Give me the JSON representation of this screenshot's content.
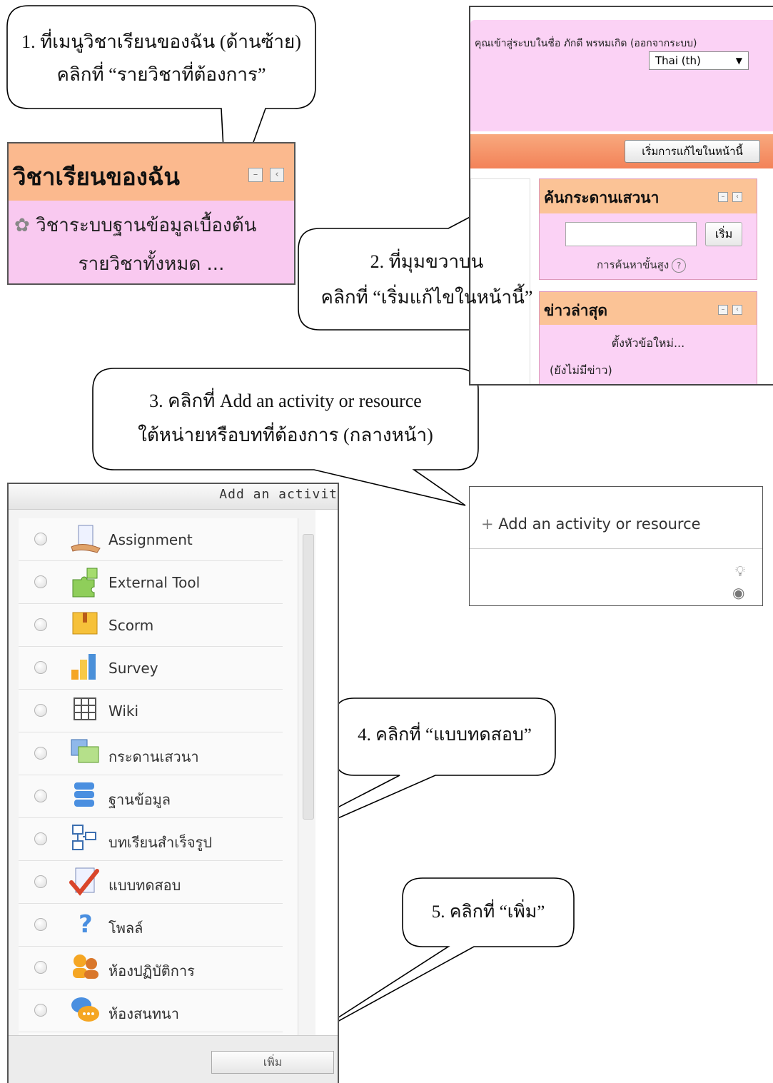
{
  "callouts": {
    "step1": {
      "line1": "1. ที่เมนูวิชาเรียนของฉัน (ด้านซ้าย)",
      "line2": "คลิกที่ “รายวิชาที่ต้องการ”"
    },
    "step2": {
      "line1": "2. ที่มุมขวาบน",
      "line2": "คลิกที่ “เริ่มแก้ไขในหน้านี้”"
    },
    "step3": {
      "line1": "3. คลิกที่ Add an activity or resource",
      "line2": "ใต้หน่ายหรือบทที่ต้องการ (กลางหน้า)"
    },
    "step4": {
      "text": "4. คลิกที่  “แบบทดสอบ”"
    },
    "step5": {
      "text": "5. คลิกที่  “เพิ่ม”"
    }
  },
  "my_courses": {
    "title": "วิชาเรียนของฉัน",
    "course": "วิชาระบบฐานข้อมูลเบื้องต้น",
    "all_courses": "รายวิชาทั้งหมด ..."
  },
  "top_right": {
    "login_text": "คุณเข้าสู่ระบบในชื่อ ภักดี พรหมเกิด (ออกจากระบบ)",
    "language": "Thai (th)",
    "edit_button": "เริ่มการแก้ไขในหน้านี้",
    "search_block_title": "ค้นกระดานเสวนา",
    "search_button": "เริ่ม",
    "advanced_search": "การค้นหาขั้นสูง",
    "news_block_title": "ข่าวล่าสุด",
    "new_topic": "ตั้งหัวข้อใหม่...",
    "no_news": "(ยังไม่มีข่าว)"
  },
  "add_activity": {
    "plus": "+",
    "label": "Add an activity or resource"
  },
  "chooser": {
    "title": "Add an activit",
    "items": [
      {
        "label": "Assignment",
        "icon": "assignment-icon"
      },
      {
        "label": "External Tool",
        "icon": "external-tool-icon"
      },
      {
        "label": "Scorm",
        "icon": "scorm-icon"
      },
      {
        "label": "Survey",
        "icon": "survey-icon"
      },
      {
        "label": "Wiki",
        "icon": "wiki-icon"
      },
      {
        "label": "กระดานเสวนา",
        "icon": "forum-icon"
      },
      {
        "label": "ฐานข้อมูล",
        "icon": "database-icon"
      },
      {
        "label": "บทเรียนสำเร็จรูป",
        "icon": "lesson-icon"
      },
      {
        "label": "แบบทดสอบ",
        "icon": "quiz-icon"
      },
      {
        "label": "โพลล์",
        "icon": "poll-icon"
      },
      {
        "label": "ห้องปฏิบัติการ",
        "icon": "workshop-icon"
      },
      {
        "label": "ห้องสนทนา",
        "icon": "chat-icon"
      }
    ],
    "add_button": "เพิ่ม"
  },
  "colors": {
    "block_pink": "#fbd2f5",
    "block_header_orange": "#fbc396",
    "bar_orange": "#f38258"
  }
}
